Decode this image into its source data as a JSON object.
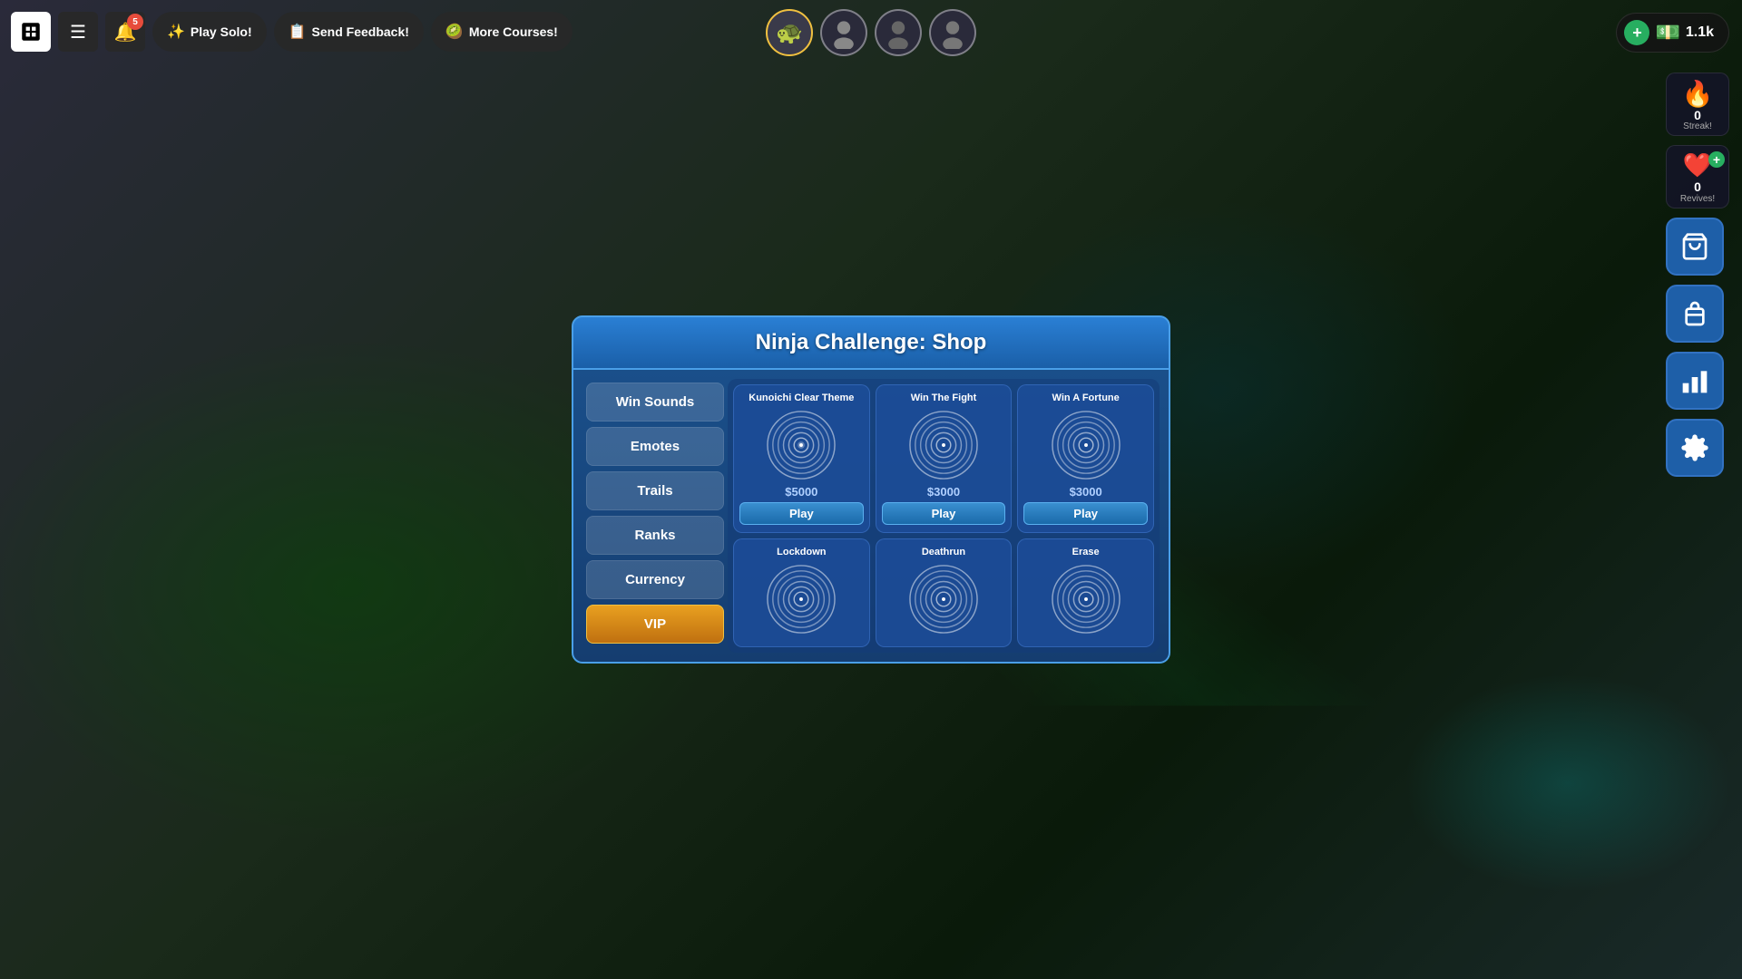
{
  "app": {
    "logo": "■",
    "notifications_count": "5"
  },
  "topbar": {
    "buttons": [
      {
        "id": "play-solo",
        "emoji": "✨",
        "label": "Play Solo!"
      },
      {
        "id": "send-feedback",
        "emoji": "📋",
        "label": "Send Feedback!"
      },
      {
        "id": "more-courses",
        "emoji": "🥝",
        "label": "More Courses!"
      }
    ]
  },
  "currency": {
    "amount": "1.1k",
    "add_label": "+"
  },
  "streak": {
    "count": "0",
    "label": "Streak!"
  },
  "revives": {
    "count": "0",
    "label": "Revives!"
  },
  "modal": {
    "title": "Ninja Challenge: Shop",
    "nav_items": [
      {
        "id": "win-sounds",
        "label": "Win Sounds",
        "active": false
      },
      {
        "id": "emotes",
        "label": "Emotes",
        "active": false
      },
      {
        "id": "trails",
        "label": "Trails",
        "active": false
      },
      {
        "id": "ranks",
        "label": "Ranks",
        "active": false
      },
      {
        "id": "currency",
        "label": "Currency",
        "active": false
      },
      {
        "id": "vip",
        "label": "VIP",
        "active": true
      }
    ],
    "shop_items": [
      {
        "id": "kunoichi",
        "label": "Kunoichi Clear Theme",
        "price": "$5000",
        "show_play": true
      },
      {
        "id": "win-fight",
        "label": "Win The Fight",
        "price": "$3000",
        "show_play": true
      },
      {
        "id": "win-fortune",
        "label": "Win A Fortune",
        "price": "$3000",
        "show_play": true
      },
      {
        "id": "lockdown",
        "label": "Lockdown",
        "price": "",
        "show_play": false
      },
      {
        "id": "deathrun",
        "label": "Deathrun",
        "price": "",
        "show_play": false
      },
      {
        "id": "erase",
        "label": "Erase",
        "price": "",
        "show_play": false
      }
    ],
    "play_label": "Play"
  },
  "players": [
    {
      "id": "p1",
      "emoji": "🐢",
      "active": true
    },
    {
      "id": "p2",
      "emoji": "👤",
      "active": false
    },
    {
      "id": "p3",
      "emoji": "👤",
      "active": false
    },
    {
      "id": "p4",
      "emoji": "👤",
      "active": false
    }
  ]
}
